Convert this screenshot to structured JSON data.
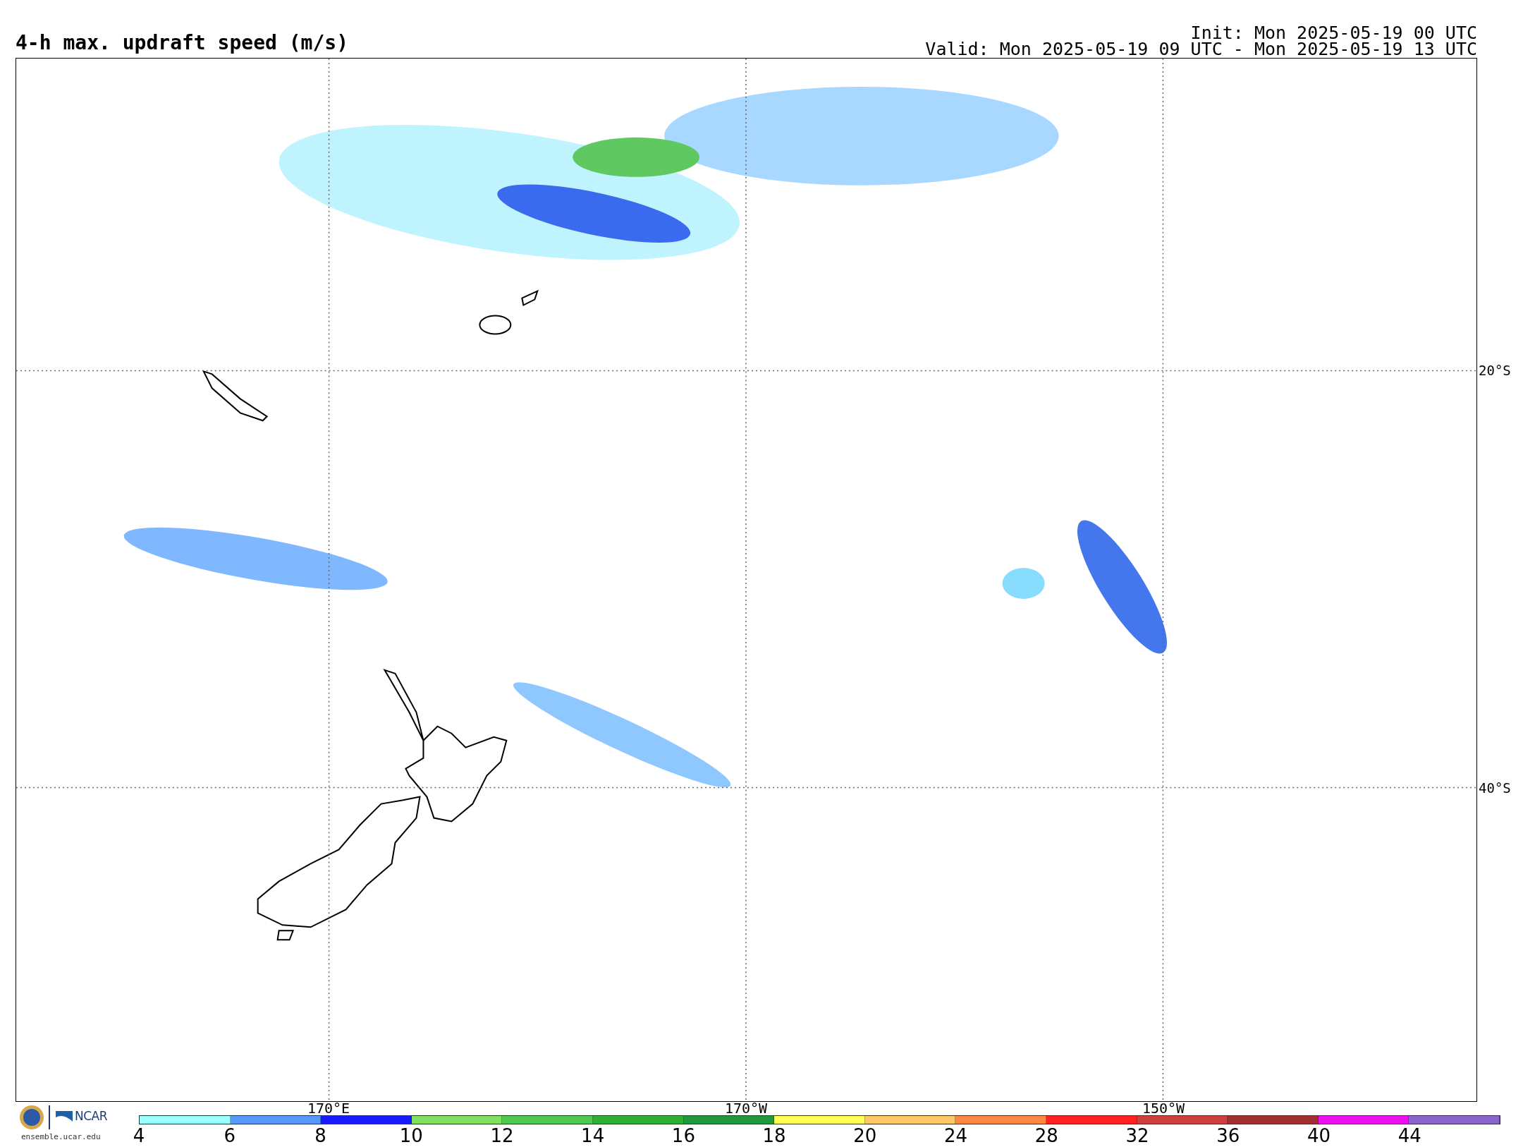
{
  "title": "4-h max. updraft speed (m/s)",
  "init": "Init: Mon 2025-05-19 00 UTC",
  "valid": "Valid: Mon 2025-05-19 09 UTC - Mon 2025-05-19 13 UTC",
  "map": {
    "lat_labels": [
      "20°S",
      "40°S"
    ],
    "lon_labels": [
      "170°E",
      "170°W",
      "150°W"
    ]
  },
  "logo": {
    "name": "NCAR",
    "url": "ensemble.ucar.edu"
  },
  "colorbar": {
    "segments": [
      {
        "color": "#99ffff"
      },
      {
        "color": "#5599ff"
      },
      {
        "color": "#1a1aff"
      },
      {
        "color": "#80e060"
      },
      {
        "color": "#50c850"
      },
      {
        "color": "#30b030"
      },
      {
        "color": "#209840"
      },
      {
        "color": "#ffff55"
      },
      {
        "color": "#ffc866"
      },
      {
        "color": "#ff8844"
      },
      {
        "color": "#ff2020"
      },
      {
        "color": "#cc4040"
      },
      {
        "color": "#a03030"
      },
      {
        "color": "#ee10ee"
      },
      {
        "color": "#8866cc"
      }
    ],
    "ticks": [
      "4",
      "6",
      "8",
      "10",
      "12",
      "14",
      "16",
      "18",
      "20",
      "24",
      "28",
      "32",
      "36",
      "40",
      "44"
    ]
  }
}
